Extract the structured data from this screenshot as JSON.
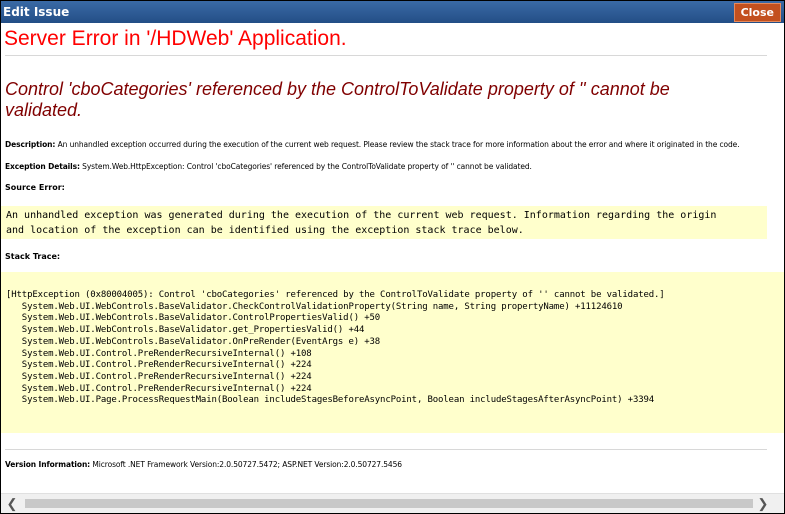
{
  "dialog": {
    "title": "Edit Issue",
    "close_label": "Close"
  },
  "error": {
    "heading": "Server Error in '/HDWeb' Application.",
    "message": "Control 'cboCategories' referenced by the ControlToValidate property of '' cannot be validated.",
    "description_label": "Description:",
    "description_text": " An unhandled exception occurred during the execution of the current web request. Please review the stack trace for more information about the error and where it originated in the code.",
    "exception_label": "Exception Details:",
    "exception_text": " System.Web.HttpException: Control 'cboCategories' referenced by the ControlToValidate property of '' cannot be validated.",
    "source_error_label": "Source Error:",
    "source_error_lines": [
      "An unhandled exception was generated during the execution of the current web request. Information regarding the origin",
      "and location of the exception can be identified using the exception stack trace below."
    ],
    "stack_trace_label": "Stack Trace:",
    "stack_trace_lines": [
      "[HttpException (0x80004005): Control 'cboCategories' referenced by the ControlToValidate property of '' cannot be validated.]",
      "   System.Web.UI.WebControls.BaseValidator.CheckControlValidationProperty(String name, String propertyName) +11124610",
      "   System.Web.UI.WebControls.BaseValidator.ControlPropertiesValid() +50",
      "   System.Web.UI.WebControls.BaseValidator.get_PropertiesValid() +44",
      "   System.Web.UI.WebControls.BaseValidator.OnPreRender(EventArgs e) +38",
      "   System.Web.UI.Control.PreRenderRecursiveInternal() +108",
      "   System.Web.UI.Control.PreRenderRecursiveInternal() +224",
      "   System.Web.UI.Control.PreRenderRecursiveInternal() +224",
      "   System.Web.UI.Control.PreRenderRecursiveInternal() +224",
      "   System.Web.UI.Page.ProcessRequestMain(Boolean includeStagesBeforeAsyncPoint, Boolean includeStagesAfterAsyncPoint) +3394"
    ],
    "version_label": "Version Information:",
    "version_text": " Microsoft .NET Framework Version:2.0.50727.5472; ASP.NET Version:2.0.50727.5456"
  },
  "scrollbar": {
    "left_arrow_icon": "chevron-left-icon",
    "right_arrow_icon": "chevron-right-icon"
  },
  "colors": {
    "titlebar": "#2c5a94",
    "close_button": "#c3501e",
    "heading": "#ff0000",
    "message": "#800000",
    "code_background": "#ffffcc"
  }
}
